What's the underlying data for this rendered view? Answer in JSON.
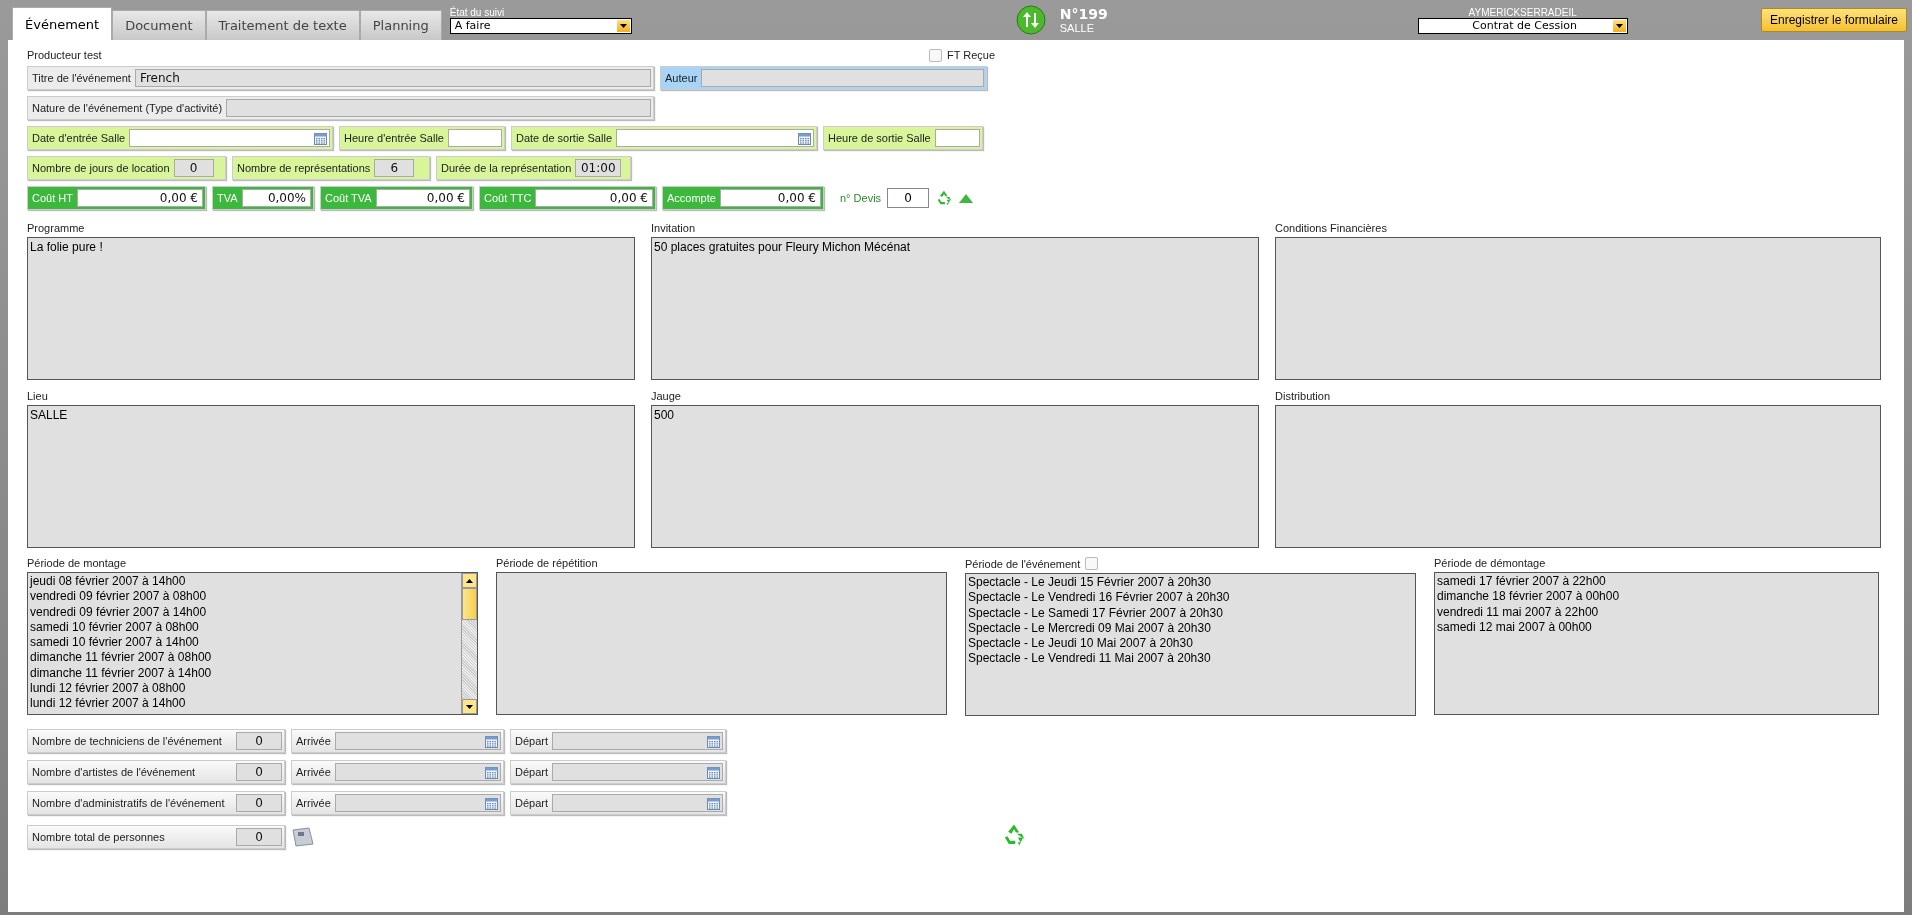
{
  "tabs": [
    {
      "label": "Événement",
      "selected": true
    },
    {
      "label": "Document",
      "selected": false
    },
    {
      "label": "Traitement de texte",
      "selected": false
    },
    {
      "label": "Planning",
      "selected": false
    }
  ],
  "status_field": {
    "label": "État du suivi",
    "value": "A faire"
  },
  "record": {
    "number": "N°199",
    "place": "SALLE"
  },
  "user": {
    "name": "AYMERICKSERRADEIL",
    "contract": "Contrat de Cession"
  },
  "save_button": "Enregistrer le formulaire",
  "producer": "Producteur test",
  "ft_recue": {
    "label": "FT Reçue",
    "checked": false
  },
  "rows": [
    [
      {
        "kind": "text",
        "color": "#ececec",
        "readonly": true,
        "label": "Titre de l'événement",
        "value": "French"
      },
      {
        "kind": "text",
        "color": "#a8d4f8",
        "readonly": true,
        "label": "Auteur"
      }
    ],
    [
      {
        "kind": "text",
        "color": "#ececec",
        "readonly": true,
        "label": "Nature de l'événement (Type d'activité)"
      }
    ],
    [
      {
        "kind": "date",
        "color": "#d8f59a",
        "readonly": false,
        "label": "Date d'entrée Salle"
      },
      {
        "kind": "text",
        "color": "#d8f59a",
        "readonly": false,
        "label": "Heure d'entrée Salle"
      },
      {
        "kind": "date",
        "color": "#d8f59a",
        "readonly": false,
        "label": "Date de sortie Salle"
      },
      {
        "kind": "text",
        "color": "#d8f59a",
        "readonly": false,
        "label": "Heure de sortie Salle"
      }
    ],
    [
      {
        "kind": "number",
        "color": "#d8f59a",
        "readonly": true,
        "label": "Nombre de jours de location",
        "value": "0"
      },
      {
        "kind": "number",
        "color": "#d8f59a",
        "readonly": true,
        "label": "Nombre de représentations",
        "value": "6"
      },
      {
        "kind": "number",
        "color": "#d8f59a",
        "readonly": true,
        "label": "Durée de la représentation",
        "value": "01:00"
      }
    ],
    [
      {
        "kind": "money",
        "color": "#3cb83c",
        "readonly": false,
        "label": "Coût HT",
        "value": "0,00 €"
      },
      {
        "kind": "money",
        "color": "#3cb83c",
        "readonly": false,
        "label": "TVA",
        "value": "0,00%"
      },
      {
        "kind": "money",
        "color": "#3cb83c",
        "readonly": false,
        "label": "Coût TVA",
        "value": "0,00 €"
      },
      {
        "kind": "money",
        "color": "#3cb83c",
        "readonly": false,
        "label": "Coût TTC",
        "value": "0,00 €"
      },
      {
        "kind": "money",
        "color": "#3cb83c",
        "readonly": false,
        "label": "Accompte",
        "value": "0,00 €"
      }
    ]
  ],
  "devis": {
    "label": "n° Devis",
    "value": "0"
  },
  "notes": [
    {
      "label": "Programme",
      "value": "La folie pure !"
    },
    {
      "label": "Invitation",
      "value": "50 places gratuites pour Fleury Michon Mécénat"
    },
    {
      "label": "Conditions Financières"
    },
    {
      "label": "Lieu",
      "value": "SALLE"
    },
    {
      "label": "Jauge",
      "value": "500"
    },
    {
      "label": "Distribution"
    }
  ],
  "periods": [
    {
      "label": "Période de montage",
      "kind": "scroll",
      "entries": [
        "jeudi 08 février 2007 à 14h00",
        "vendredi 09 février 2007 à 08h00",
        "vendredi 09 février 2007 à 14h00",
        "samedi 10 février 2007 à 08h00",
        "samedi 10 février 2007 à 14h00",
        "dimanche 11 février 2007 à 08h00",
        "dimanche 11 février 2007 à 14h00",
        "lundi 12 février 2007 à 08h00",
        "lundi 12 février 2007 à 14h00"
      ]
    },
    {
      "label": "Période de répétition",
      "kind": "plain"
    },
    {
      "label": "Période de l'événement",
      "kind": "checkbox",
      "checked": false,
      "entries": [
        "Spectacle - Le Jeudi 15 Février 2007 à 20h30",
        "Spectacle - Le Vendredi 16 Février 2007 à 20h30",
        "Spectacle - Le Samedi 17 Février 2007 à 20h30",
        "Spectacle - Le Mercredi 09 Mai 2007 à 20h30",
        "Spectacle - Le Jeudi 10 Mai 2007 à 20h30",
        "Spectacle - Le Vendredi 11 Mai 2007 à 20h30"
      ]
    },
    {
      "label": "Période de démontage",
      "kind": "plain",
      "entries": [
        "samedi 17 février 2007 à 22h00",
        "dimanche 18 février 2007 à 00h00",
        "vendredi 11 mai 2007 à 22h00",
        "samedi 12 mai 2007 à 00h00"
      ]
    }
  ],
  "staff": [
    {
      "label": "Nombre de techniciens de l'événement",
      "value": "0",
      "arrival": "Arrivée",
      "departure": "Départ"
    },
    {
      "label": "Nombre d'artistes de l'événement",
      "value": "0",
      "arrival": "Arrivée",
      "departure": "Départ"
    },
    {
      "label": "Nombre d'administratifs de l'événement",
      "value": "0",
      "arrival": "Arrivée",
      "departure": "Départ"
    }
  ],
  "total": {
    "label": "Nombre total de personnes",
    "value": "0"
  }
}
